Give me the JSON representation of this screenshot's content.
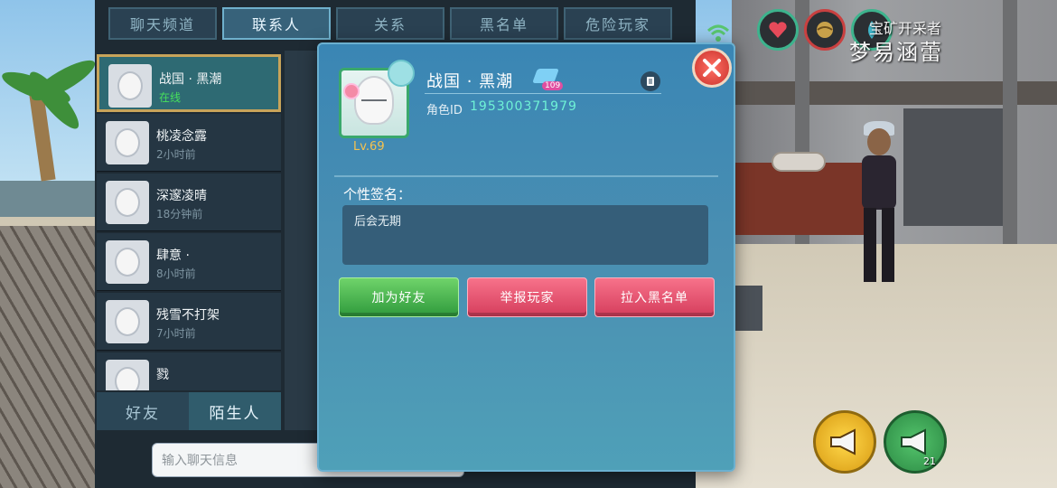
{
  "tabs": [
    {
      "label": "聊天频道",
      "active": false
    },
    {
      "label": "联系人",
      "active": true
    },
    {
      "label": "关系",
      "active": false
    },
    {
      "label": "黑名单",
      "active": false
    },
    {
      "label": "危险玩家",
      "active": false
    }
  ],
  "contacts": [
    {
      "name": "战国 · 黑潮",
      "status": "在线",
      "active": true
    },
    {
      "name": "桃凌念露",
      "status": "2小时前"
    },
    {
      "name": "深邃凌晴",
      "status": "18分钟前"
    },
    {
      "name": "肆意 ·",
      "status": "8小时前"
    },
    {
      "name": "残雪不打架",
      "status": "7小时前"
    },
    {
      "name": "戮",
      "status": ""
    }
  ],
  "bottom_tabs": {
    "friends": "好友",
    "strangers": "陌生人"
  },
  "chat_input": {
    "placeholder": "输入聊天信息"
  },
  "hud": {
    "player_title": "宝矿开采者",
    "player_name": "梦易涵蕾",
    "horn_count": "21",
    "status_icons": [
      "heart-icon",
      "ball-icon",
      "drop-icon"
    ]
  },
  "profile": {
    "name": "战国 · 黑潮",
    "badge_level": "109",
    "id_label": "角色ID",
    "id_value": "195300371979",
    "level": "Lv.69",
    "signature_label": "个性签名：",
    "signature": "后会无期",
    "buttons": {
      "add_friend": "加为好友",
      "report": "举报玩家",
      "blacklist": "拉入黑名单"
    }
  },
  "colors": {
    "accent_id": "#6ff2d6",
    "level": "#f5c24f",
    "online": "#47e05c",
    "button_green": "#2f9a3c",
    "button_red": "#d53d5c"
  }
}
